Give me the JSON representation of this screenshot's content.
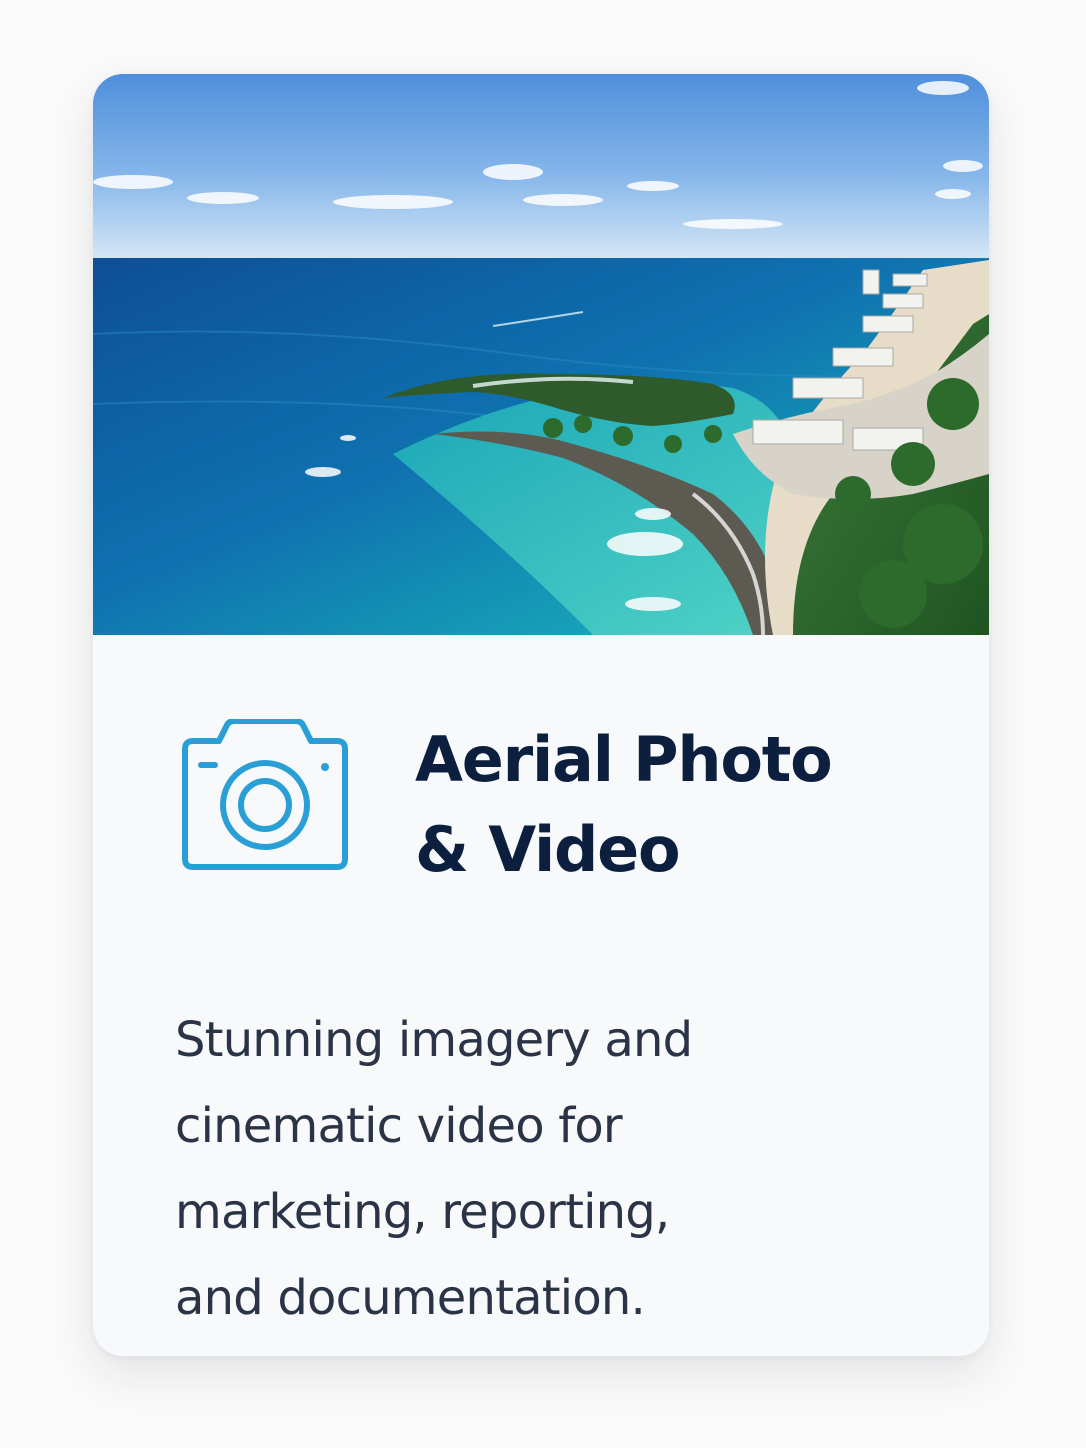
{
  "card": {
    "image": {
      "description": "aerial view of a turquoise coastline with a beach, palm trees and hotels"
    },
    "icon": "camera-icon",
    "title_lines": [
      "Aerial Photo",
      "& Video"
    ],
    "description_lines": [
      "Stunning imagery and",
      "cinematic video for",
      "marketing, reporting,",
      "and documentation."
    ]
  },
  "colors": {
    "accent": "#2a9fd6",
    "title": "#0d1f3f",
    "body_text": "#2b3446",
    "card_background": "#f8f9fb",
    "page_background": "#fafafa"
  }
}
